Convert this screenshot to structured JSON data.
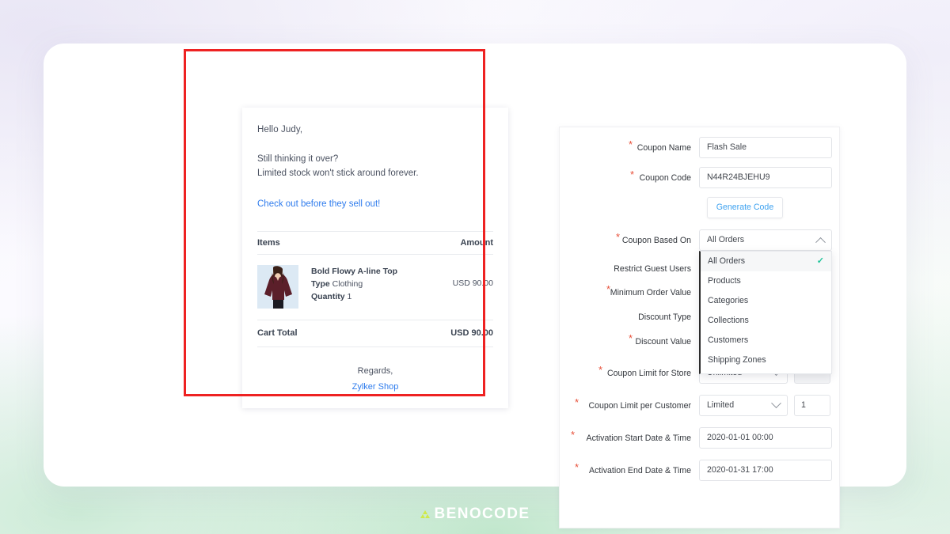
{
  "email_preview": {
    "greeting": "Hello Judy,",
    "line1": "Still thinking it over?",
    "line2": "Limited stock won't stick around forever.",
    "cta": "Check out before they sell out!",
    "table": {
      "col_items": "Items",
      "col_amount": "Amount",
      "rows": [
        {
          "title": "Bold Flowy A-line Top",
          "type_label": "Type",
          "type_value": "Clothing",
          "quantity_label": "Quantity",
          "quantity_value": "1",
          "amount": "USD 90.00",
          "thumb_alt": "product-photo-maroon-top"
        }
      ],
      "total_label": "Cart Total",
      "total_amount": "USD 90.00"
    },
    "regards": "Regards,",
    "shop_name": "Zylker Shop"
  },
  "coupon_form": {
    "rows": [
      {
        "label": "Coupon Name",
        "required": true,
        "value": "Flash Sale"
      },
      {
        "label": "Coupon Code",
        "required": true,
        "value": "N44R24BJEHU9"
      }
    ],
    "generate_button": "Generate Code",
    "based_on": {
      "label": "Coupon Based On",
      "required": true,
      "value": "All Orders",
      "expanded": true,
      "options": [
        "All Orders",
        "Products",
        "Categories",
        "Collections",
        "Customers",
        "Shipping Zones"
      ],
      "selected_index": 0
    },
    "hidden_labels": [
      {
        "label": "Restrict Guest Users",
        "required": false
      },
      {
        "label": "Minimum Order Value",
        "required": true
      },
      {
        "label": "Discount Type",
        "required": false
      },
      {
        "label": "Discount Value",
        "required": true
      }
    ],
    "limit_store": {
      "label": "Coupon Limit for Store",
      "required": true,
      "select_value": "Unlimited",
      "number_value": "∞",
      "number_disabled": true
    },
    "limit_customer": {
      "label": "Coupon Limit per Customer",
      "required": true,
      "select_value": "Limited",
      "number_value": "1",
      "number_disabled": false
    },
    "start_date": {
      "label": "Activation Start Date & Time",
      "required": true,
      "value": "2020-01-01 00:00"
    },
    "end_date": {
      "label": "Activation End Date & Time",
      "required": true,
      "value": "2020-01-31 17:00"
    }
  },
  "footer": {
    "brand": "BENOCODE"
  },
  "colors": {
    "highlight": "#ee2222",
    "link": "#2f7ced",
    "accent_blue": "#3ea2f0",
    "required_star": "#e8503a",
    "check_green": "#1fc49a",
    "logo_mark": "#cfe94a"
  }
}
